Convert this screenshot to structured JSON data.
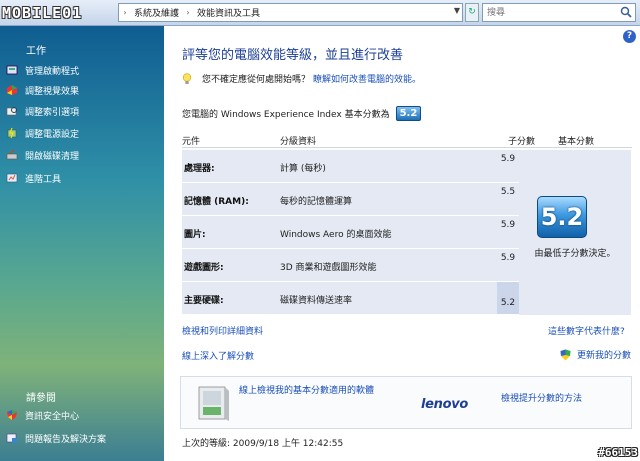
{
  "topbar": {
    "logo_text": "MOBILE01",
    "breadcrumbs": [
      "系統及維護",
      "效能資訊及工具"
    ],
    "search_placeholder": "搜尋"
  },
  "sidebar": {
    "tasks_heading": "工作",
    "items": [
      {
        "label": "管理啟動程式",
        "icon": "startup-icon"
      },
      {
        "label": "調整視覺效果",
        "icon": "visual-effects-icon"
      },
      {
        "label": "調整索引選項",
        "icon": "index-icon"
      },
      {
        "label": "調整電源設定",
        "icon": "power-icon"
      },
      {
        "label": "開啟磁碟清理",
        "icon": "disk-cleanup-icon"
      },
      {
        "label": "進階工具",
        "icon": "advanced-tools-icon"
      }
    ],
    "see_also_heading": "請參閱",
    "see_also": [
      {
        "label": "資訊安全中心",
        "icon": "security-shield-icon"
      },
      {
        "label": "問題報告及解決方案",
        "icon": "problem-reports-icon"
      }
    ]
  },
  "main": {
    "title": "評等您的電腦效能等級，並且進行改善",
    "tip_text": "您不確定應從何處開始嗎？",
    "tip_link": "瞭解如何改善電腦的效能。",
    "wei_label": "您電腦的 Windows Experience Index 基本分數為",
    "wei_score": "5.2",
    "table": {
      "headers": {
        "component": "元件",
        "rated": "分級資料",
        "subscore": "子分數",
        "basescore": "基本分數"
      },
      "rows": [
        {
          "component": "處理器:",
          "desc": "計算 (每秒)",
          "subscore": "5.9"
        },
        {
          "component": "記憶體 (RAM):",
          "desc": "每秒的記憶體運算",
          "subscore": "5.5"
        },
        {
          "component": "圖片:",
          "desc": "Windows Aero 的桌面效能",
          "subscore": "5.9"
        },
        {
          "component": "遊戲圖形:",
          "desc": "3D 商業和遊戲圖形效能",
          "subscore": "5.9"
        },
        {
          "component": "主要硬碟:",
          "desc": "磁碟資料傳送速率",
          "subscore": "5.2"
        }
      ],
      "base_score": "5.2",
      "base_note": "由最低子分數決定。"
    },
    "links": {
      "print_details": "檢視和列印詳細資料",
      "what_numbers": "這些數字代表什麼?",
      "learn_online": "線上深入了解分數",
      "update_score": "更新我的分數"
    },
    "promo": {
      "text": "線上檢視我的基本分數適用的軟體",
      "brand": "lenovo",
      "link": "檢視提升分數的方法"
    },
    "last_rated": "上次的等級: 2009/9/18 上午 12:42:55"
  },
  "watermark": "#66153",
  "colors": {
    "link": "#1a4fb8",
    "title": "#1c3f95",
    "table_bg": "#e4e9f3",
    "badge": "#3c98e0"
  }
}
